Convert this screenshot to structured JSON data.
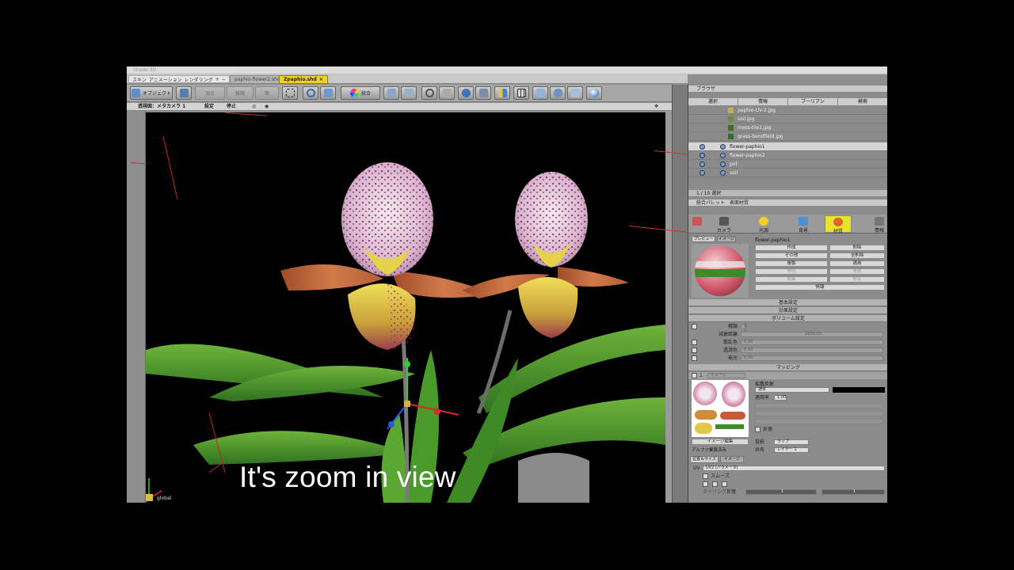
{
  "titlebar": {
    "text": "Shade 3D"
  },
  "menu": {
    "items": [
      "スキン",
      "アニメーション",
      "レンダリング",
      "+",
      "−"
    ]
  },
  "documents": [
    {
      "label": "paphio-flower2.shd",
      "active": false
    },
    {
      "label": "Zpaphio.shd",
      "active": true,
      "close": "×"
    }
  ],
  "toolbar": {
    "object_label": "オブジェクト",
    "btn_a": "頂点",
    "btn_b": "稜線",
    "btn_c": "面",
    "merge_label": "統合"
  },
  "viewport_header": {
    "view_label": "透視図：メタカメラ 1",
    "settings_label": "設定",
    "stop_label": "停止"
  },
  "viewport": {
    "axis_label": "global",
    "caption": "It's zoom in view"
  },
  "browser": {
    "title": "ブラウザ",
    "columns": [
      "選択",
      "情報",
      "ブーリアン",
      "検索"
    ],
    "rows": [
      {
        "name": "paphio-UV-2.jpg",
        "type": "image",
        "selected": false
      },
      {
        "name": "soil.jpg",
        "type": "image",
        "selected": false
      },
      {
        "name": "moss-tile1.jpg",
        "type": "image",
        "selected": false
      },
      {
        "name": "grass-bendfield.jpg",
        "type": "image",
        "selected": false
      },
      {
        "name": "flower-paphio1",
        "type": "part",
        "selected": true
      },
      {
        "name": "flower-paphio2",
        "type": "part",
        "selected": false
      },
      {
        "name": "pot",
        "type": "part",
        "selected": false
      },
      {
        "name": "soil",
        "type": "part",
        "selected": false
      }
    ],
    "footer": "1 / 10 選択"
  },
  "palette": {
    "title": "統合パレット　表面材質",
    "tabs": [
      {
        "label": "カメラ",
        "color": "#9a9a9a"
      },
      {
        "label": "光源",
        "color": "#f1d21f"
      },
      {
        "label": "背景",
        "color": "#4f8fd0"
      },
      {
        "label": "材質",
        "color": "#e0652a",
        "active": true
      },
      {
        "label": "情報",
        "color": "#777777"
      }
    ],
    "preview_tab": "プレビュー",
    "image_tab": "イメージ",
    "material_name": "flower-paphio1",
    "buttons": [
      "作成",
      "削除",
      "その他",
      "全削除",
      "複製",
      "適用",
      "情報"
    ],
    "dim_buttons": [
      "参照",
      "複製",
      "編集",
      "設定"
    ],
    "sections": [
      "基本設定",
      "効果設定",
      "ボリューム設定"
    ],
    "volume": {
      "type_label": "種類",
      "type_value": "なし",
      "decay_label": "減衰距離",
      "decay_value": "1000.00",
      "scatter_label": "散乱色",
      "scatter_value": "0.00",
      "transmit_label": "透過色",
      "transmit_value": "0.00",
      "emit_label": "発光",
      "emit_value": "0.00"
    },
    "mapping_section": "マッピング",
    "mapping": {
      "index": "1",
      "type": "イメージ",
      "blend_label": "拡散反射",
      "mode_label": "通常",
      "rate_label": "適用率",
      "rate_value": "1.00",
      "edit_button": "イメージ編集",
      "alpha_label": "アルファ乗算済み",
      "repeat_label": "反復",
      "wrap_label": "投影",
      "wrap_value": "ラップ",
      "channel_label": "共有",
      "channel_value": "レイヤー 1"
    },
    "subtabs": [
      "位置＆サイズ",
      "イメージ"
    ],
    "uv": {
      "label": "UV",
      "value": "UV2 (パラメータ)",
      "smooth_label": "スムーズ",
      "tiling_label": "タイリング",
      "repeat_label": "反復",
      "value1": "1",
      "value2": "1"
    }
  },
  "colors": {
    "active_tab": "#f1d21f",
    "panel": "#8c8c8c",
    "leaf": "#4e9a2c",
    "petal": "#d7ccd6"
  }
}
